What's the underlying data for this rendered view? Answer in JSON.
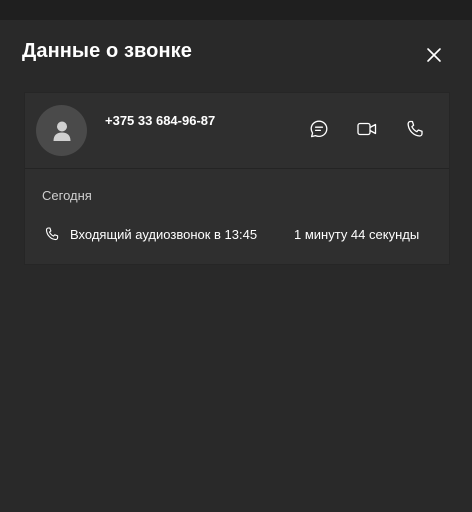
{
  "panel": {
    "title": "Данные о звонке"
  },
  "contact": {
    "phone": "+375 33 684-96-87"
  },
  "actions": [
    {
      "name": "chat",
      "icon": "chat-icon"
    },
    {
      "name": "video-call",
      "icon": "video-icon"
    },
    {
      "name": "audio-call",
      "icon": "phone-icon"
    }
  ],
  "history": {
    "date_label": "Сегодня",
    "entries": [
      {
        "icon": "phone-icon",
        "description": "Входящий аудиозвонок в 13:45",
        "duration": "1 минуту 44 секунды"
      }
    ]
  },
  "colors": {
    "background": "#292929",
    "card": "#2f2f2f",
    "topbar": "#1f1f1f",
    "avatar": "#4a4a4a",
    "text": "#ffffff",
    "secondary_text": "#cfcfcf"
  }
}
